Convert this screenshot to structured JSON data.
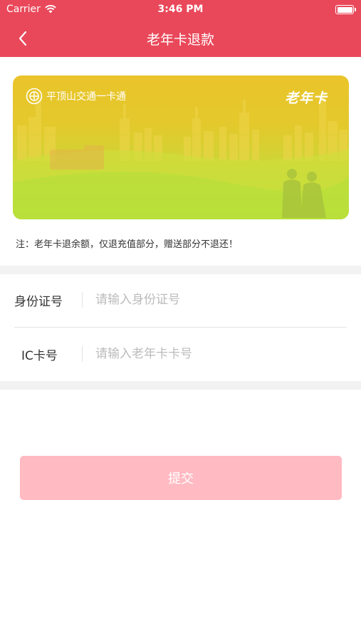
{
  "status_bar": {
    "carrier": "Carrier",
    "time": "3:46 PM",
    "wifi_icon": "wifi-icon",
    "battery_icon": "battery-icon"
  },
  "nav": {
    "title": "老年卡退款",
    "back_icon": "chevron-left-icon",
    "bg_color": "#e9485a"
  },
  "card": {
    "brand_name": "平顶山交通一卡通",
    "card_type": "老年卡",
    "logo_icon": "transit-card-logo-icon"
  },
  "note": "注：老年卡退余额，仅退充值部分，赠送部分不退还！",
  "form": {
    "id_label": "身份证号",
    "id_placeholder": "请输入身份证号",
    "ic_label": "IC卡号",
    "ic_placeholder": "请输入老年卡卡号"
  },
  "submit_label": "提交",
  "colors": {
    "accent": "#e9485a",
    "submit_disabled": "#ffbac2"
  }
}
